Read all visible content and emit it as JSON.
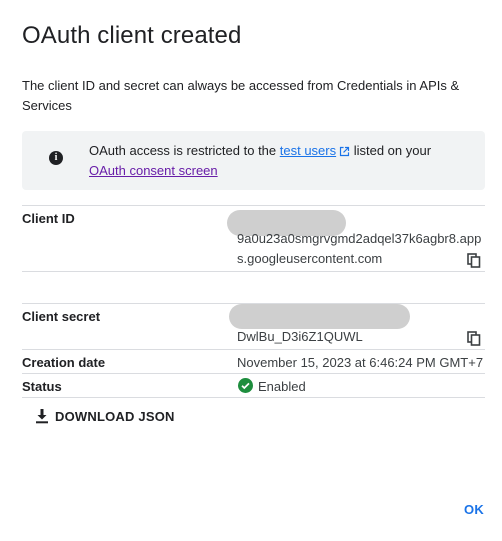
{
  "dialog": {
    "title": "OAuth client created",
    "intro": "The client ID and secret can always be accessed from Credentials in APIs & Services"
  },
  "notice": {
    "prefix": "OAuth access is restricted to the ",
    "link_test_users": "test users",
    "middle": " listed on your",
    "link_consent": "OAuth consent screen"
  },
  "fields": {
    "client_id_label": "Client ID",
    "client_id_line1": "9a0u23a0smgrvgmd2adqel37k6agbr8.app",
    "client_id_line2": "s.googleusercontent.com",
    "client_secret_label": "Client secret",
    "client_secret_value": "DwlBu_D3i6Z1QUWL",
    "creation_date_label": "Creation date",
    "creation_date_value": "November 15, 2023 at 6:46:24 PM GMT+7",
    "status_label": "Status",
    "status_value": "Enabled"
  },
  "actions": {
    "download_json": "DOWNLOAD JSON",
    "ok": "OK"
  },
  "colors": {
    "accent": "#1a73e8",
    "enabled": "#1e8e3e"
  }
}
